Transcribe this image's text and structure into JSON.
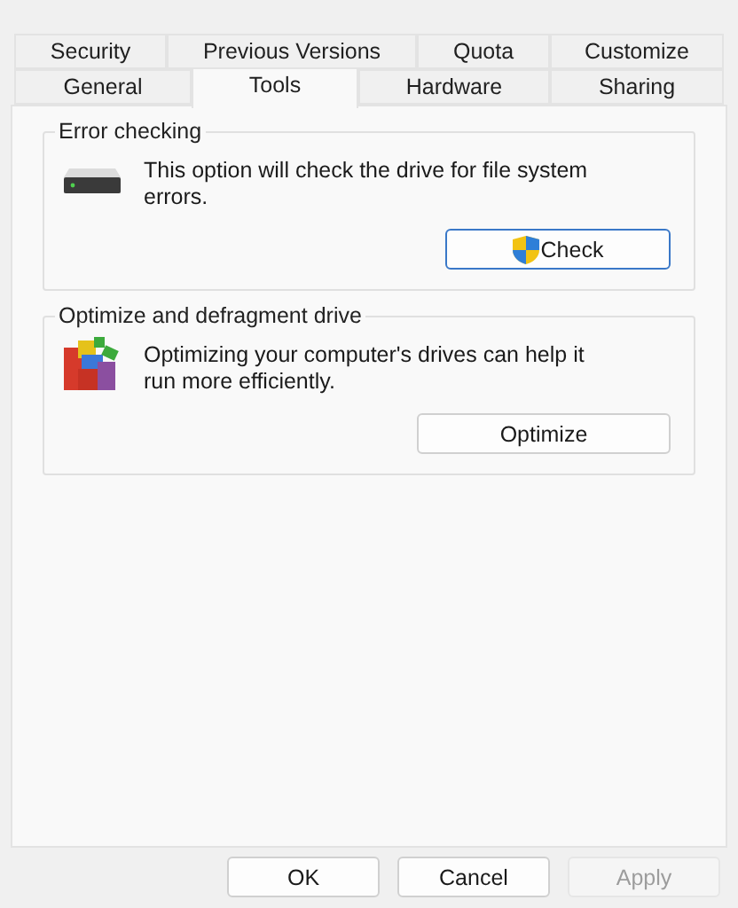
{
  "tab_rows": [
    [
      {
        "label": "Security",
        "selected": false
      },
      {
        "label": "Previous Versions",
        "selected": false
      },
      {
        "label": "Quota",
        "selected": false
      },
      {
        "label": "Customize",
        "selected": false
      }
    ],
    [
      {
        "label": "General",
        "selected": false
      },
      {
        "label": "Tools",
        "selected": true
      },
      {
        "label": "Hardware",
        "selected": false
      },
      {
        "label": "Sharing",
        "selected": false
      }
    ]
  ],
  "groups": [
    {
      "title": "Error checking",
      "kind": "drive",
      "description": "This option will check the drive for file system errors.",
      "button": {
        "label": "Check",
        "shield": true
      }
    },
    {
      "title": "Optimize and defragment drive",
      "kind": "defrag",
      "description": "Optimizing your computer's drives can help it run more efficiently.",
      "button": {
        "label": "Optimize",
        "shield": false
      }
    }
  ],
  "buttons": [
    {
      "label": "OK",
      "disabled": false
    },
    {
      "label": "Cancel",
      "disabled": false
    },
    {
      "label": "Apply",
      "disabled": true
    }
  ]
}
